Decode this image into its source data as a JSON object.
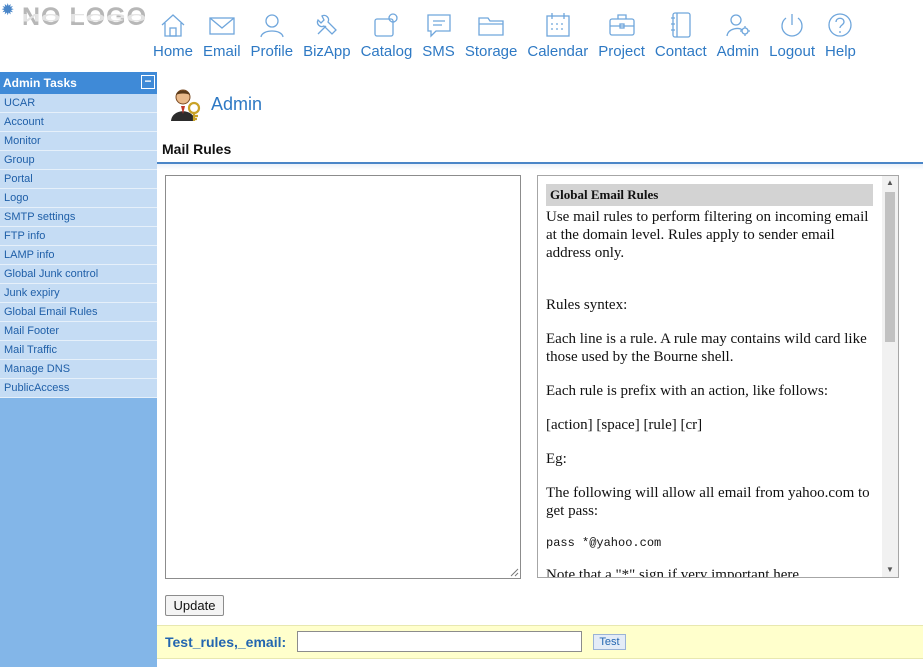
{
  "logo": {
    "text": "NO LOGO"
  },
  "nav": [
    {
      "label": "Home",
      "icon": "home-icon"
    },
    {
      "label": "Email",
      "icon": "email-icon"
    },
    {
      "label": "Profile",
      "icon": "profile-icon"
    },
    {
      "label": "BizApp",
      "icon": "bizapp-icon"
    },
    {
      "label": "Catalog",
      "icon": "catalog-icon"
    },
    {
      "label": "SMS",
      "icon": "sms-icon"
    },
    {
      "label": "Storage",
      "icon": "storage-icon"
    },
    {
      "label": "Calendar",
      "icon": "calendar-icon"
    },
    {
      "label": "Project",
      "icon": "project-icon"
    },
    {
      "label": "Contact",
      "icon": "contact-icon"
    },
    {
      "label": "Admin",
      "icon": "admin-icon"
    },
    {
      "label": "Logout",
      "icon": "logout-icon"
    },
    {
      "label": "Help",
      "icon": "help-icon"
    }
  ],
  "sidebar": {
    "title": "Admin Tasks",
    "collapse_symbol": "−",
    "items": [
      "UCAR",
      "Account",
      "Monitor",
      "Group",
      "Portal",
      "Logo",
      "SMTP settings",
      "FTP info",
      "LAMP info",
      "Global Junk control",
      "Junk expiry",
      "Global Email Rules",
      "Mail Footer",
      "Mail Traffic",
      "Manage DNS",
      "PublicAccess"
    ]
  },
  "main": {
    "page_title": "Admin",
    "section_title": "Mail Rules",
    "rules_value": "",
    "update_label": "Update",
    "test_label": "Test_rules,_email:",
    "test_value": "",
    "test_button": "Test"
  },
  "help": {
    "heading": "Global Email Rules",
    "intro": "Use mail rules to perform filtering on incoming email at the domain level. Rules apply to sender email address only.",
    "syntax_title": "Rules syntex:",
    "p1": "Each line is a rule. A rule may contains wild card like those used by the Bourne shell.",
    "p2": "Each rule is prefix with an action, like follows:",
    "p3": "[action] [space] [rule] [cr]",
    "p4": "Eg:",
    "p5": "The following will allow all email from yahoo.com to get pass:",
    "code": "pass *@yahoo.com",
    "p6": "Note that a \"*\" sign if very important here."
  },
  "colors": {
    "accent": "#2e79c4",
    "sidebar_bg": "#83b6e8",
    "sidebar_header": "#3f8ad7",
    "test_bar": "#ffffcc"
  }
}
